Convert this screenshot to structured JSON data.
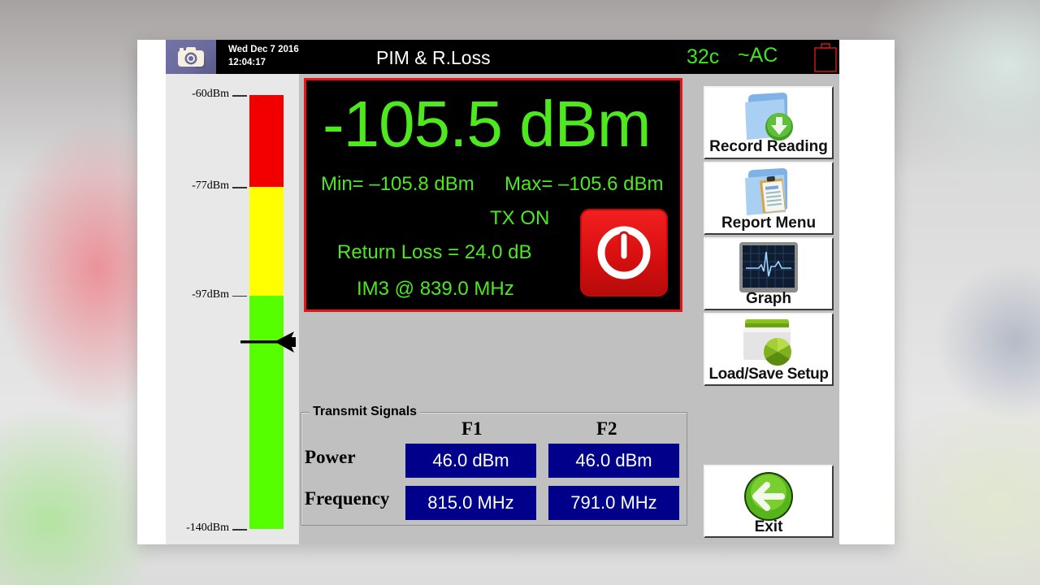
{
  "header": {
    "camera_icon": "camera-icon",
    "date": "Wed Dec 7 2016",
    "time": "12:04:17",
    "title": "PIM & R.Loss",
    "temperature": "32c",
    "power_source": "~AC",
    "battery_icon": "battery-empty-icon",
    "status_color": "#3fe51c"
  },
  "gauge": {
    "unit": "dBm",
    "scale_min": -140,
    "scale_max": -60,
    "ticks": [
      {
        "label": "-60dBm",
        "value": -60
      },
      {
        "label": "-77dBm",
        "value": -77
      },
      {
        "label": "-97dBm",
        "value": -97
      },
      {
        "label": "-140dBm",
        "value": -140
      }
    ],
    "zones": [
      {
        "from": -77,
        "to": -60,
        "color": "#f20000"
      },
      {
        "from": -97,
        "to": -77,
        "color": "#ffff00"
      },
      {
        "from": -140,
        "to": -97,
        "color": "#55ff00"
      }
    ],
    "indicator_value": -105.5,
    "indicator_icon": "arrow-left-icon"
  },
  "display": {
    "reading": "-105.5 dBm",
    "min": "Min= –105.8 dBm",
    "max": "Max= –105.6 dBm",
    "tx_status": "TX ON",
    "return_loss": "Return Loss = 24.0 dB",
    "im3": "IM3 @ 839.0 MHz",
    "power_button_icon": "power-icon",
    "text_color": "#4de81e",
    "border_color": "#e8141a"
  },
  "transmit": {
    "legend": "Transmit Signals",
    "columns": [
      "F1",
      "F2"
    ],
    "rows": [
      {
        "label": "Power",
        "values": [
          "46.0 dBm",
          "46.0 dBm"
        ]
      },
      {
        "label": "Frequency",
        "values": [
          "815.0 MHz",
          "791.0 MHz"
        ]
      }
    ]
  },
  "buttons": [
    {
      "label": "Record Reading",
      "icon": "folder-download-icon"
    },
    {
      "label": "Report Menu",
      "icon": "folder-report-icon"
    },
    {
      "label": "Graph",
      "icon": "graph-monitor-icon"
    },
    {
      "label": "Load/Save Setup",
      "icon": "folder-setup-icon"
    },
    {
      "label": "Exit",
      "icon": "exit-arrow-icon"
    }
  ]
}
